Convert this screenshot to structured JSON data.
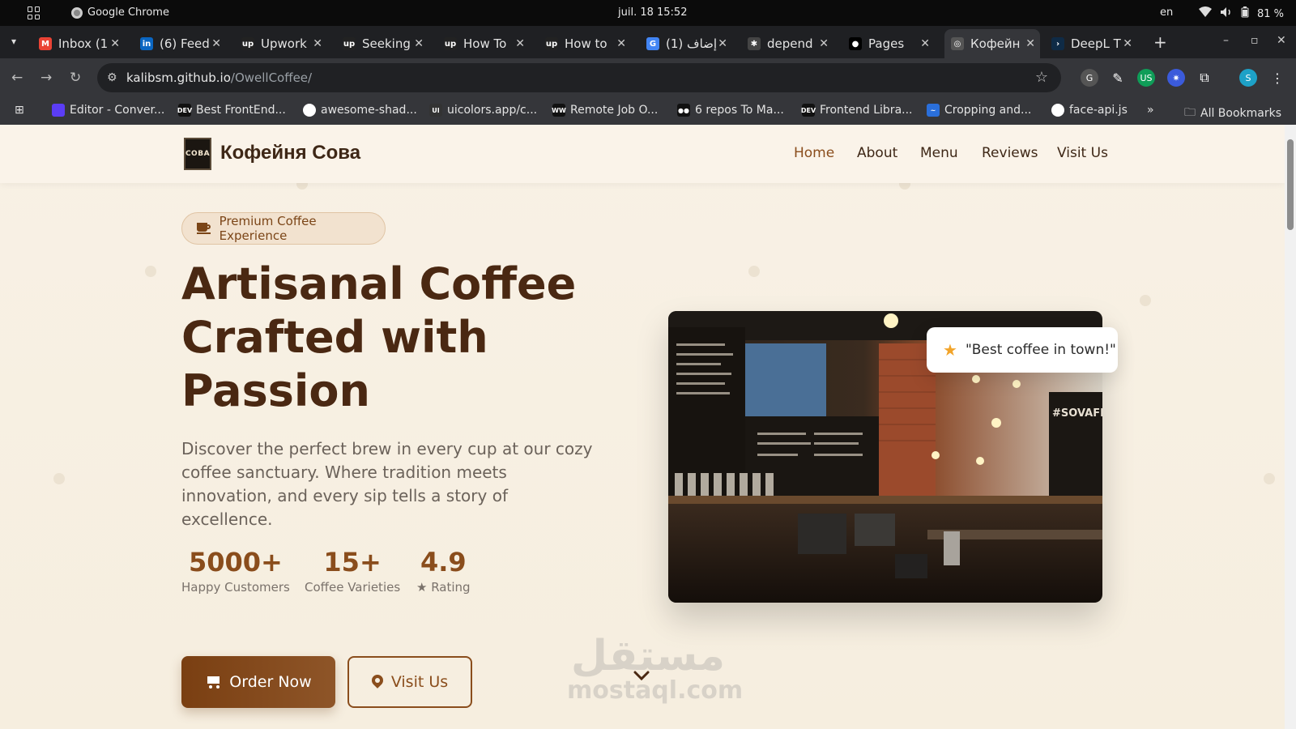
{
  "os": {
    "app_name": "Google Chrome",
    "datetime": "juil. 18  15:52",
    "lang": "en",
    "battery": "81 %"
  },
  "tabs": [
    {
      "title": "Inbox (1",
      "icon": "gmail-icon",
      "color": "#ea4335",
      "glyph": "M"
    },
    {
      "title": "(6) Feed",
      "icon": "linkedin-icon",
      "color": "#0a66c2",
      "glyph": "in"
    },
    {
      "title": "Upwork",
      "icon": "upwork-icon",
      "color": "#222",
      "glyph": "up"
    },
    {
      "title": "Seeking",
      "icon": "upwork-icon",
      "color": "#222",
      "glyph": "up"
    },
    {
      "title": "How To",
      "icon": "upwork-icon",
      "color": "#222",
      "glyph": "up"
    },
    {
      "title": "How to",
      "icon": "upwork-icon",
      "color": "#222",
      "glyph": "up"
    },
    {
      "title": "(1) إضاف",
      "icon": "google-icon",
      "color": "#4285f4",
      "glyph": "G"
    },
    {
      "title": "depend",
      "icon": "gear-icon",
      "color": "#444",
      "glyph": "✱"
    },
    {
      "title": "Pages",
      "icon": "github-icon",
      "color": "#000",
      "glyph": "●"
    },
    {
      "title": "Кофейн",
      "icon": "globe-icon",
      "color": "#555",
      "glyph": "◎"
    },
    {
      "title": "DeepL T",
      "icon": "deepl-icon",
      "color": "#0f2b46",
      "glyph": "›"
    }
  ],
  "address": {
    "domain": "kalibsm.github.io",
    "path": "/OwellCoffee/"
  },
  "bookmarks": [
    {
      "label": "Editor - Conver...",
      "color": "#5b3df5",
      "glyph": ""
    },
    {
      "label": "Best FrontEnd...",
      "color": "#111",
      "glyph": "DEV"
    },
    {
      "label": "awesome-shad...",
      "color": "#fff",
      "glyph": ""
    },
    {
      "label": "uicolors.app/c...",
      "color": "#333",
      "glyph": "UI"
    },
    {
      "label": "Remote Job O...",
      "color": "#111",
      "glyph": "WW"
    },
    {
      "label": "6 repos To Ma...",
      "color": "#111",
      "glyph": "●●"
    },
    {
      "label": "Frontend Libra...",
      "color": "#111",
      "glyph": "DEV"
    },
    {
      "label": "Cropping and...",
      "color": "#2a6fdb",
      "glyph": "~"
    },
    {
      "label": "face-api.js",
      "color": "#fff",
      "glyph": ""
    }
  ],
  "bookmarks_all": "All Bookmarks",
  "site": {
    "logo_text": "СОВА",
    "brand": "Кофейня Сова",
    "nav": [
      "Home",
      "About",
      "Menu",
      "Reviews",
      "Visit Us"
    ],
    "badge": "Premium Coffee Experience",
    "title_lines": [
      "Artisanal Coffee",
      "Crafted with",
      "Passion"
    ],
    "description": "Discover the perfect brew in every cup at our cozy coffee sanctuary. Where tradition meets innovation, and every sip tells a story of excellence.",
    "stats": [
      {
        "value": "5000+",
        "label": "Happy Customers"
      },
      {
        "value": "15+",
        "label": "Coffee Varieties"
      },
      {
        "value": "4.9",
        "label": "★ Rating"
      }
    ],
    "cta_primary": "Order Now",
    "cta_secondary": "Visit Us",
    "quote": "\"Best coffee in town!\"",
    "image_chalk": "#SOVAFRIE",
    "watermark_ar": "مستقل",
    "watermark_lat": "mostaql.com"
  },
  "colors": {
    "accent": "#8a4d1c",
    "heading": "#4a2812",
    "background": "#f7f0e3"
  }
}
